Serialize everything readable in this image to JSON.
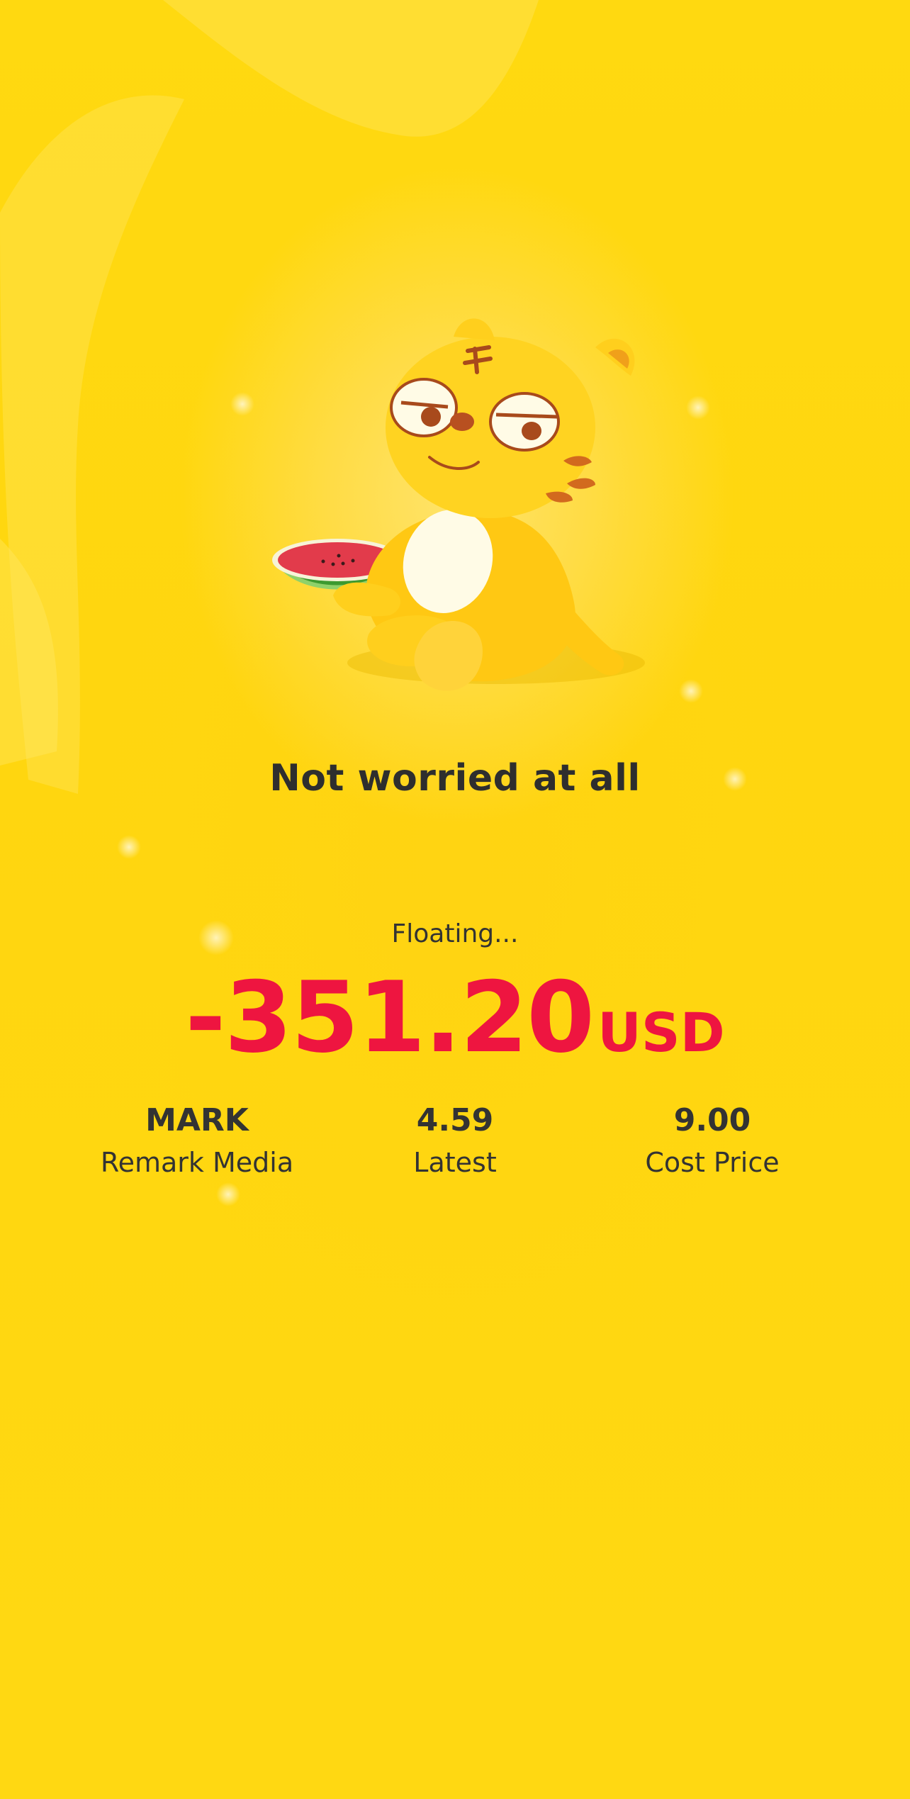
{
  "mood_text": "Not worried at all",
  "floating_label": "Floating...",
  "floating_amount": "-351.20",
  "currency": "USD",
  "stats": [
    {
      "value": "MARK",
      "label": "Remark Media"
    },
    {
      "value": "4.59",
      "label": "Latest"
    },
    {
      "value": "9.00",
      "label": "Cost Price"
    }
  ],
  "colors": {
    "background": "#ffd90a",
    "loss_red": "#ee1540",
    "text_dark": "#333333"
  },
  "icons": {
    "mascot": "tiger-mascot-with-watermelon"
  }
}
